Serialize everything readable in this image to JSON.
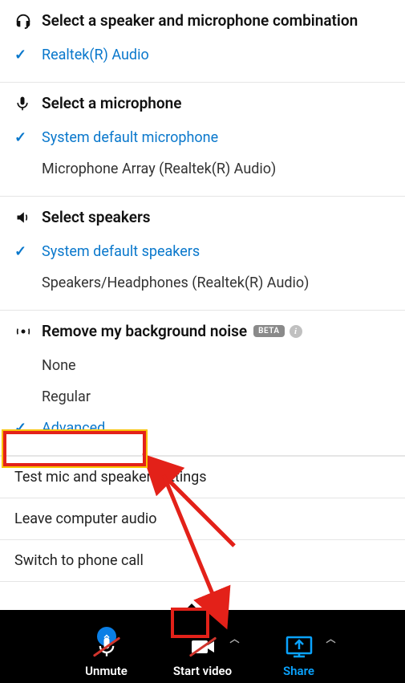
{
  "audio_combo": {
    "title": "Select a speaker and microphone combination",
    "options": [
      {
        "label": "Realtek(R) Audio",
        "selected": true
      }
    ]
  },
  "microphone": {
    "title": "Select a microphone",
    "options": [
      {
        "label": "System default microphone",
        "selected": true
      },
      {
        "label": "Microphone Array (Realtek(R) Audio)",
        "selected": false
      }
    ]
  },
  "speakers": {
    "title": "Select speakers",
    "options": [
      {
        "label": "System default speakers",
        "selected": true
      },
      {
        "label": "Speakers/Headphones (Realtek(R) Audio)",
        "selected": false
      }
    ]
  },
  "noise": {
    "title": "Remove my background noise",
    "badge": "BETA",
    "options": [
      {
        "label": "None",
        "selected": false
      },
      {
        "label": "Regular",
        "selected": false
      },
      {
        "label": "Advanced",
        "selected": true
      }
    ]
  },
  "actions": {
    "test": "Test mic and speaker settings",
    "leave": "Leave computer audio",
    "switch_phone": "Switch to phone call"
  },
  "toolbar": {
    "unmute": "Unmute",
    "start_video": "Start video",
    "share": "Share"
  },
  "annotation": {
    "highlight_advanced": true,
    "highlight_chevron": true
  }
}
